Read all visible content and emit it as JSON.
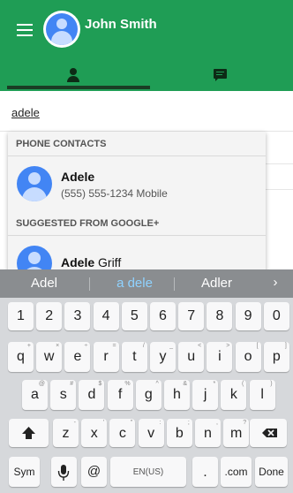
{
  "header": {
    "user_name": "John Smith",
    "menu_icon": "hamburger-menu-icon",
    "avatar_icon": "person-avatar-icon",
    "tabs": [
      {
        "icon": "person-icon",
        "selected": true
      },
      {
        "icon": "chat-message-icon",
        "selected": false
      }
    ],
    "brand_color": "#1f9d55",
    "indicator_color": "#1a3d24"
  },
  "search": {
    "value": "adele"
  },
  "dropdown": {
    "sections": [
      {
        "title": "PHONE CONTACTS"
      },
      {
        "title": "SUGGESTED FROM GOOGLE+"
      }
    ],
    "phone_contact": {
      "name": "Adele",
      "detail": "(555) 555-1234 Mobile"
    },
    "google_contact": {
      "name_bold": "Adele",
      "name_rest": " Griff"
    }
  },
  "keyboard": {
    "suggestions": [
      "Adel",
      "a dele",
      "Adler"
    ],
    "suggestion_arrow": "›",
    "numbers": [
      "1",
      "2",
      "3",
      "4",
      "5",
      "6",
      "7",
      "8",
      "9",
      "0"
    ],
    "row1": [
      {
        "k": "q",
        "s": "+"
      },
      {
        "k": "w",
        "s": "×"
      },
      {
        "k": "e",
        "s": "÷"
      },
      {
        "k": "r",
        "s": "="
      },
      {
        "k": "t",
        "s": "/"
      },
      {
        "k": "y",
        "s": "_"
      },
      {
        "k": "u",
        "s": "<"
      },
      {
        "k": "i",
        "s": ">"
      },
      {
        "k": "o",
        "s": "["
      },
      {
        "k": "p",
        "s": "]"
      }
    ],
    "row2": [
      {
        "k": "a",
        "s": "@"
      },
      {
        "k": "s",
        "s": "#"
      },
      {
        "k": "d",
        "s": "$"
      },
      {
        "k": "f",
        "s": "%"
      },
      {
        "k": "g",
        "s": "^"
      },
      {
        "k": "h",
        "s": "&"
      },
      {
        "k": "j",
        "s": "*"
      },
      {
        "k": "k",
        "s": "("
      },
      {
        "k": "l",
        "s": ")"
      }
    ],
    "row3": [
      {
        "k": "z",
        "s": "-"
      },
      {
        "k": "x",
        "s": "'"
      },
      {
        "k": "c",
        "s": "\""
      },
      {
        "k": "v",
        "s": ":"
      },
      {
        "k": "b",
        "s": ";"
      },
      {
        "k": "n",
        "s": ","
      },
      {
        "k": "m",
        "s": "?"
      }
    ],
    "shift_icon": "shift-arrow-icon",
    "backspace_icon": "backspace-icon",
    "sym_label": "Sym",
    "mic_icon": "microphone-icon",
    "at_label": "@",
    "space_label": "EN(US)",
    "period_label": ".",
    "com_label": ".com",
    "done_label": "Done"
  }
}
